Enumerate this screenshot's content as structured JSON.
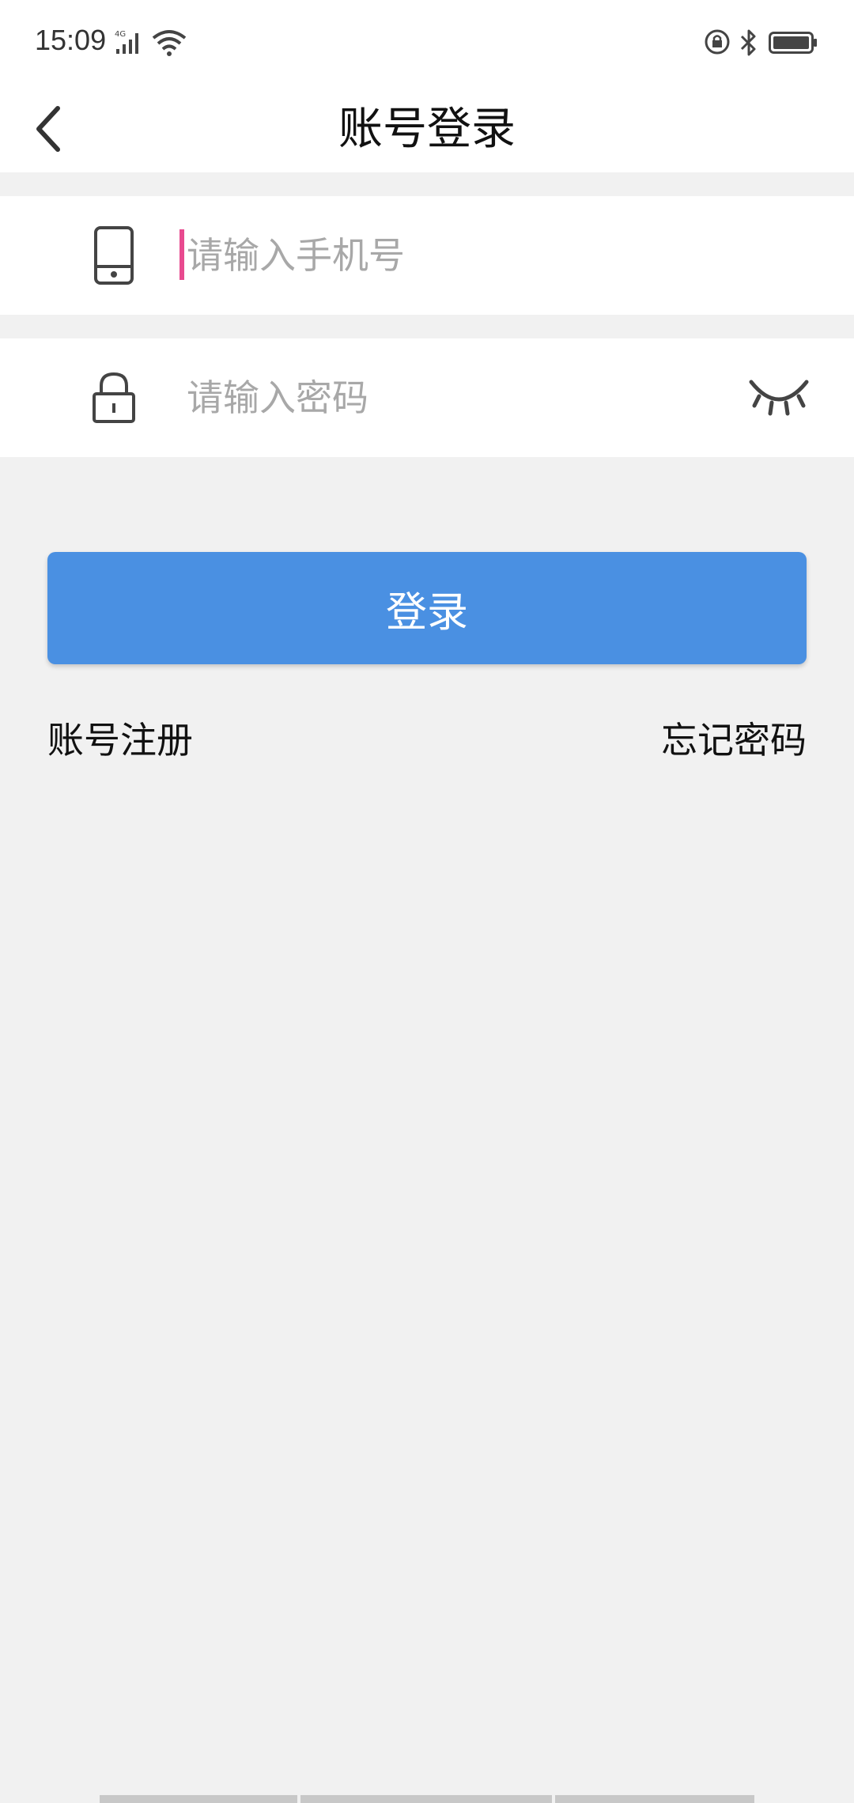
{
  "status_bar": {
    "time": "15:09",
    "signal_label": "4G",
    "icons": [
      "signal-icon",
      "wifi-icon",
      "lock-rotation-icon",
      "bluetooth-icon",
      "battery-icon"
    ]
  },
  "header": {
    "title": "账号登录",
    "back_icon": "chevron-left-icon"
  },
  "form": {
    "phone": {
      "icon": "phone-icon",
      "placeholder": "请输入手机号",
      "value": ""
    },
    "password": {
      "icon": "lock-icon",
      "placeholder": "请输入密码",
      "value": "",
      "toggle_icon": "eye-closed-icon"
    },
    "login_label": "登录"
  },
  "links": {
    "register": "账号注册",
    "forgot": "忘记密码"
  },
  "colors": {
    "accent": "#4a90e2",
    "caret": "#e84a8f",
    "background": "#f1f1f1"
  }
}
